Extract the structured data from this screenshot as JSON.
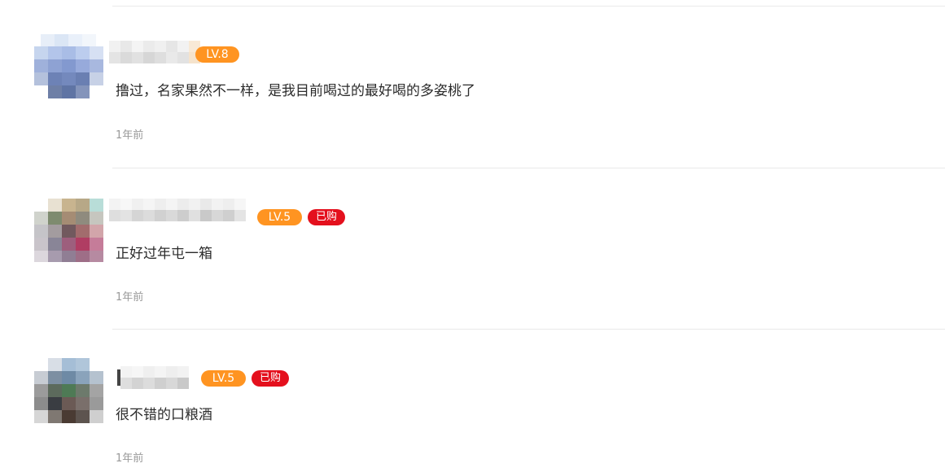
{
  "comments": [
    {
      "level_badge": "LV.8",
      "text": "撸过，名家果然不一样，是我目前喝过的最好喝的多姿桃了",
      "time": "1年前",
      "avatar": "blurred-blue-avatar"
    },
    {
      "level_badge": "LV.5",
      "bought_badge": "已购",
      "text": "正好过年屯一箱",
      "time": "1年前",
      "avatar": "blurred-colorful-avatar"
    },
    {
      "level_badge": "LV.5",
      "bought_badge": "已购",
      "text": "很不错的口粮酒",
      "time": "1年前",
      "avatar": "blurred-dark-avatar"
    }
  ],
  "colors": {
    "level_badge": "#ff9421",
    "bought_badge": "#e4101d",
    "divider": "#e9e9e9",
    "time": "#999999"
  }
}
